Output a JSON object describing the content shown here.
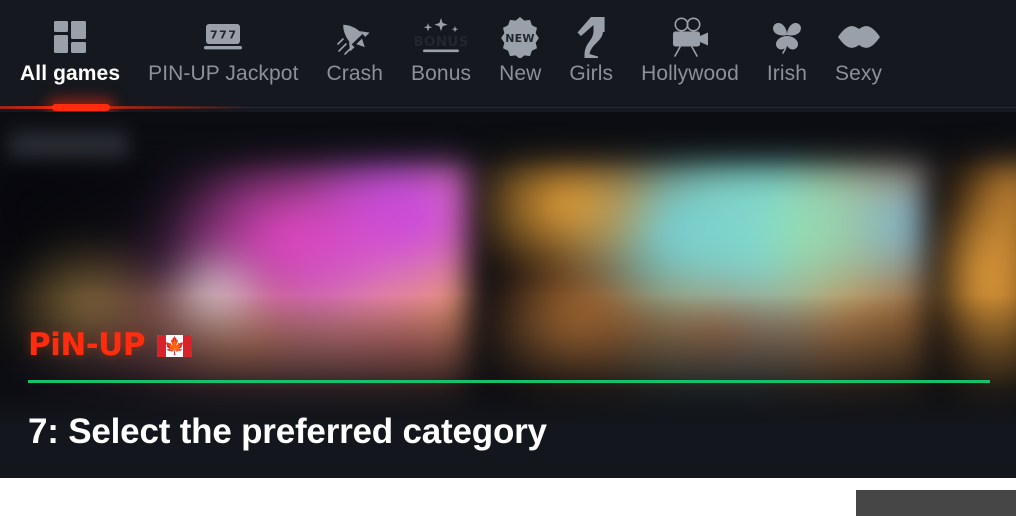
{
  "app": {
    "brand_logo_text": "PiN-UP",
    "flag_name": "canada-flag",
    "accent_red": "#ff2d0e",
    "accent_green": "#15c26b",
    "background": "#13161c"
  },
  "nav": {
    "items": [
      {
        "label": "All games",
        "icon": "grid-icon",
        "active": true
      },
      {
        "label": "PIN-UP Jackpot",
        "icon": "slot-777-icon",
        "active": false
      },
      {
        "label": "Crash",
        "icon": "rocket-icon",
        "active": false
      },
      {
        "label": "Bonus",
        "icon": "bonus-sparkle-icon",
        "active": false
      },
      {
        "label": "New",
        "icon": "new-badge-icon",
        "active": false
      },
      {
        "label": "Girls",
        "icon": "high-heel-leg-icon",
        "active": false
      },
      {
        "label": "Hollywood",
        "icon": "movie-camera-icon",
        "active": false
      },
      {
        "label": "Irish",
        "icon": "clover-icon",
        "active": false
      },
      {
        "label": "Sexy",
        "icon": "lips-icon",
        "active": false
      }
    ],
    "icon_labels": {
      "slot_reels": "777",
      "bonus": "BONUS",
      "new": "NEW"
    }
  },
  "content": {
    "chip_label": "",
    "banner_count": 3
  },
  "caption": {
    "text": "7: Select the preferred category"
  }
}
